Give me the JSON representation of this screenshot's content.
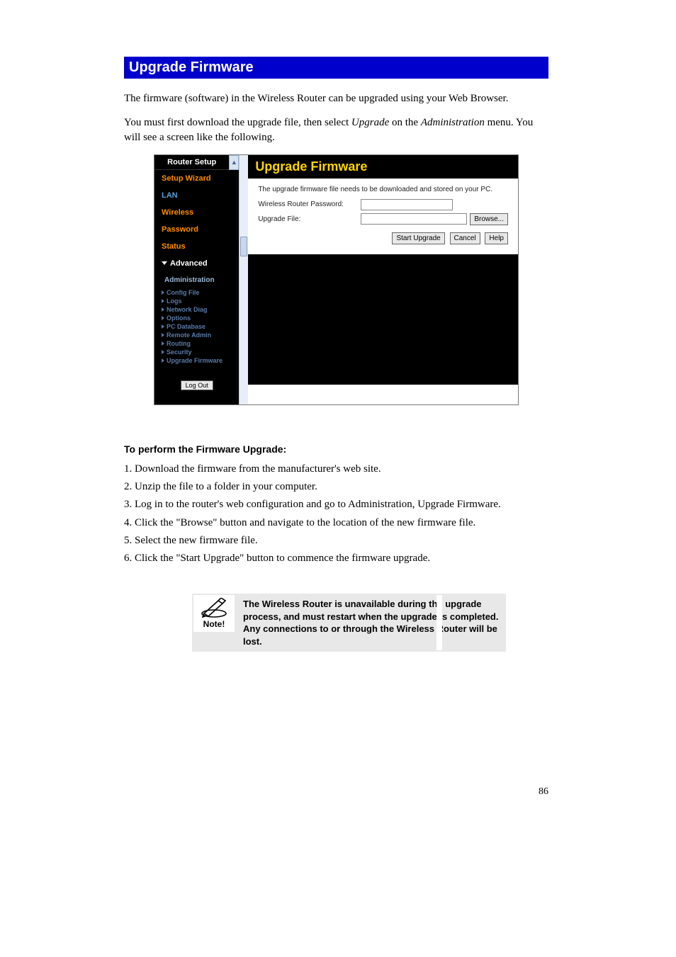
{
  "header": {
    "title": "Upgrade Firmware"
  },
  "paragraphs": {
    "p1": "The firmware (software) in the Wireless Router can be upgraded using your Web Browser.",
    "p2a": "You must first download the upgrade file, then select ",
    "p2b": "Upgrade",
    "p2c": " on the ",
    "p2d": "Administration",
    "p2e": " menu. You will see a screen like the following."
  },
  "screenshot": {
    "sidebar": {
      "header": "Router Setup",
      "items": {
        "setup_wizard": "Setup Wizard",
        "lan": "LAN",
        "wireless": "Wireless",
        "password": "Password",
        "status": "Status",
        "advanced": "Advanced",
        "administration": "Administration"
      },
      "sub": [
        "Config File",
        "Logs",
        "Network Diag",
        "Options",
        "PC Database",
        "Remote Admin",
        "Routing",
        "Security",
        "Upgrade Firmware"
      ],
      "logout": "Log Out"
    },
    "main": {
      "title": "Upgrade Firmware",
      "info": "The upgrade firmware file needs to be downloaded and stored on your PC.",
      "pw_label": "Wireless Router Password:",
      "file_label": "Upgrade File:",
      "browse": "Browse...",
      "start": "Start Upgrade",
      "cancel": "Cancel",
      "help": "Help"
    }
  },
  "steps": {
    "heading": "To perform the Firmware Upgrade:",
    "s1": "1. Download the firmware from the manufacturer's web site.",
    "s2": "2. Unzip the file to a folder in your computer.",
    "s3": "3. Log in to the router's web configuration and go to Administration, Upgrade Firmware.",
    "s4": "4. Click the \"Browse\" button and navigate to the location of the new firmware file.",
    "s5": "5. Select the new firmware file.",
    "s6": "6. Click the \"Start Upgrade\" button to commence the firmware upgrade."
  },
  "note": {
    "label": "Note!",
    "text": "The Wireless Router is unavailable during the upgrade process, and must restart when the upgrade is completed. Any connections to or through the Wireless Router will be lost."
  },
  "page": {
    "num": "86"
  }
}
